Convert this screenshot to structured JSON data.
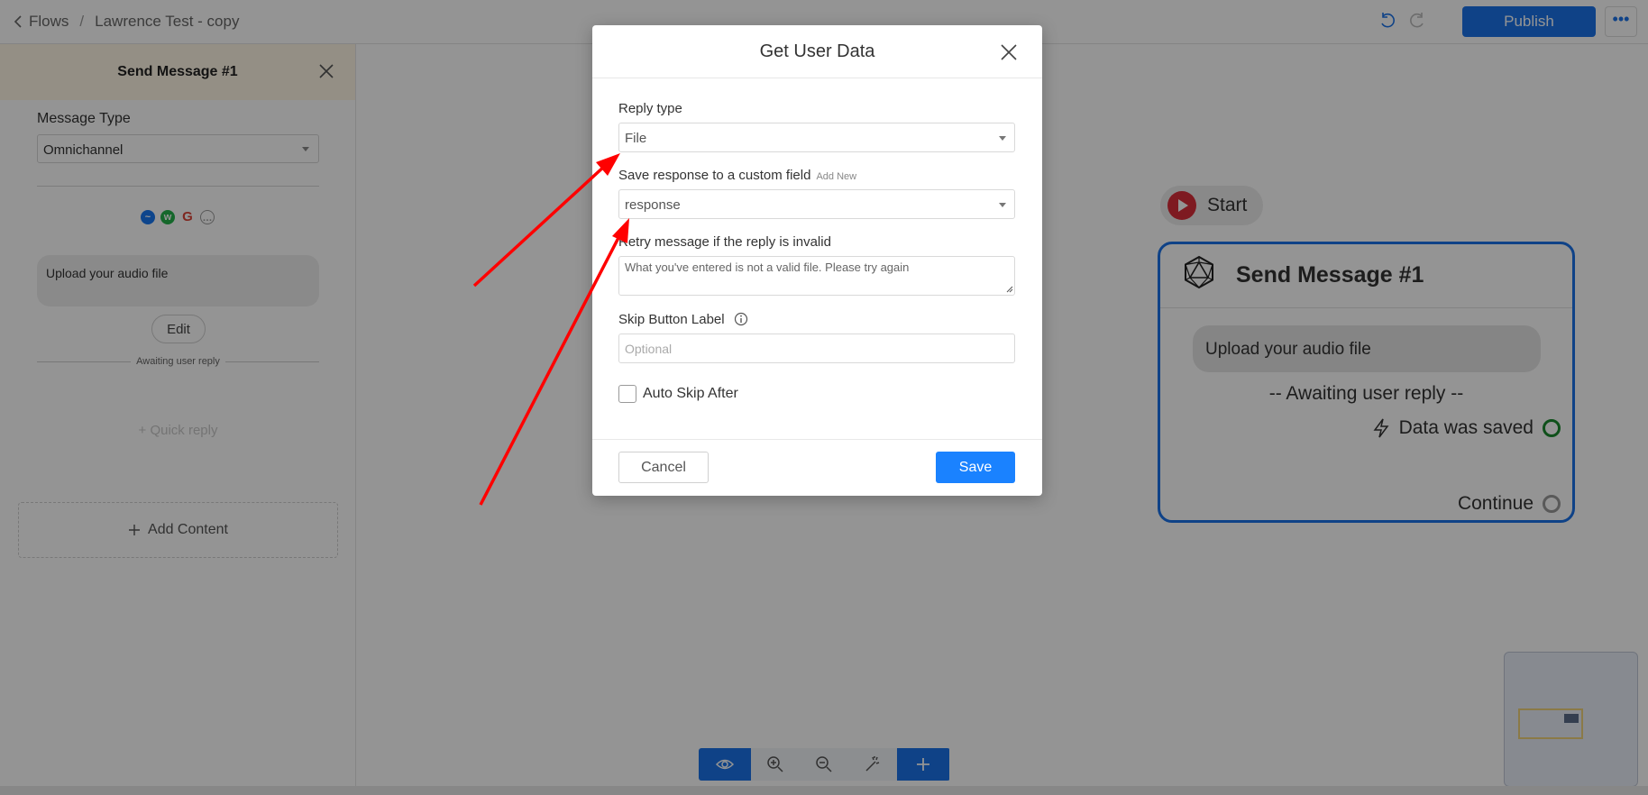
{
  "breadcrumb": {
    "back": "Flows",
    "separator": "/",
    "current": "Lawrence Test - copy"
  },
  "toolbar": {
    "publish_label": "Publish",
    "more_label": "•••"
  },
  "left_panel": {
    "title": "Send Message #1",
    "message_type_label": "Message Type",
    "message_type_value": "Omnichannel",
    "bubble_text": "Upload your audio file",
    "edit_label": "Edit",
    "awaiting_label": "Awaiting user reply",
    "quick_reply_label": "+ Quick reply",
    "add_content_label": "Add Content"
  },
  "canvas": {
    "start_label": "Start",
    "node": {
      "title": "Send Message #1",
      "bubble_text": "Upload your audio file",
      "awaiting_label": "-- Awaiting user reply --",
      "saved_label": "Data was saved",
      "continue_label": "Continue"
    }
  },
  "modal": {
    "title": "Get User Data",
    "reply_type_label": "Reply type",
    "reply_type_value": "File",
    "save_response_label": "Save response to a custom field",
    "add_new_label": "Add New",
    "save_response_value": "response",
    "retry_label": "Retry message if the reply is invalid",
    "retry_value": "What you've entered is not a valid file. Please try again",
    "skip_label": "Skip Button Label",
    "skip_placeholder": "Optional",
    "auto_skip_label": "Auto Skip After",
    "cancel_label": "Cancel",
    "save_label": "Save"
  },
  "colors": {
    "accent": "#1a73e8",
    "save_button": "#1a82ff",
    "annotation_arrow": "#ff0000",
    "start_icon": "#d92d3a",
    "saved_ring": "#1b8a2e"
  },
  "icons": [
    "chevron-left-icon",
    "undo-icon",
    "redo-icon",
    "close-icon",
    "messenger-icon",
    "whatsapp-icon",
    "google-icon",
    "sms-icon",
    "plus-icon",
    "play-icon",
    "node-icon",
    "bolt-icon",
    "eye-icon",
    "zoom-in-icon",
    "zoom-out-icon",
    "magic-icon",
    "info-icon"
  ]
}
